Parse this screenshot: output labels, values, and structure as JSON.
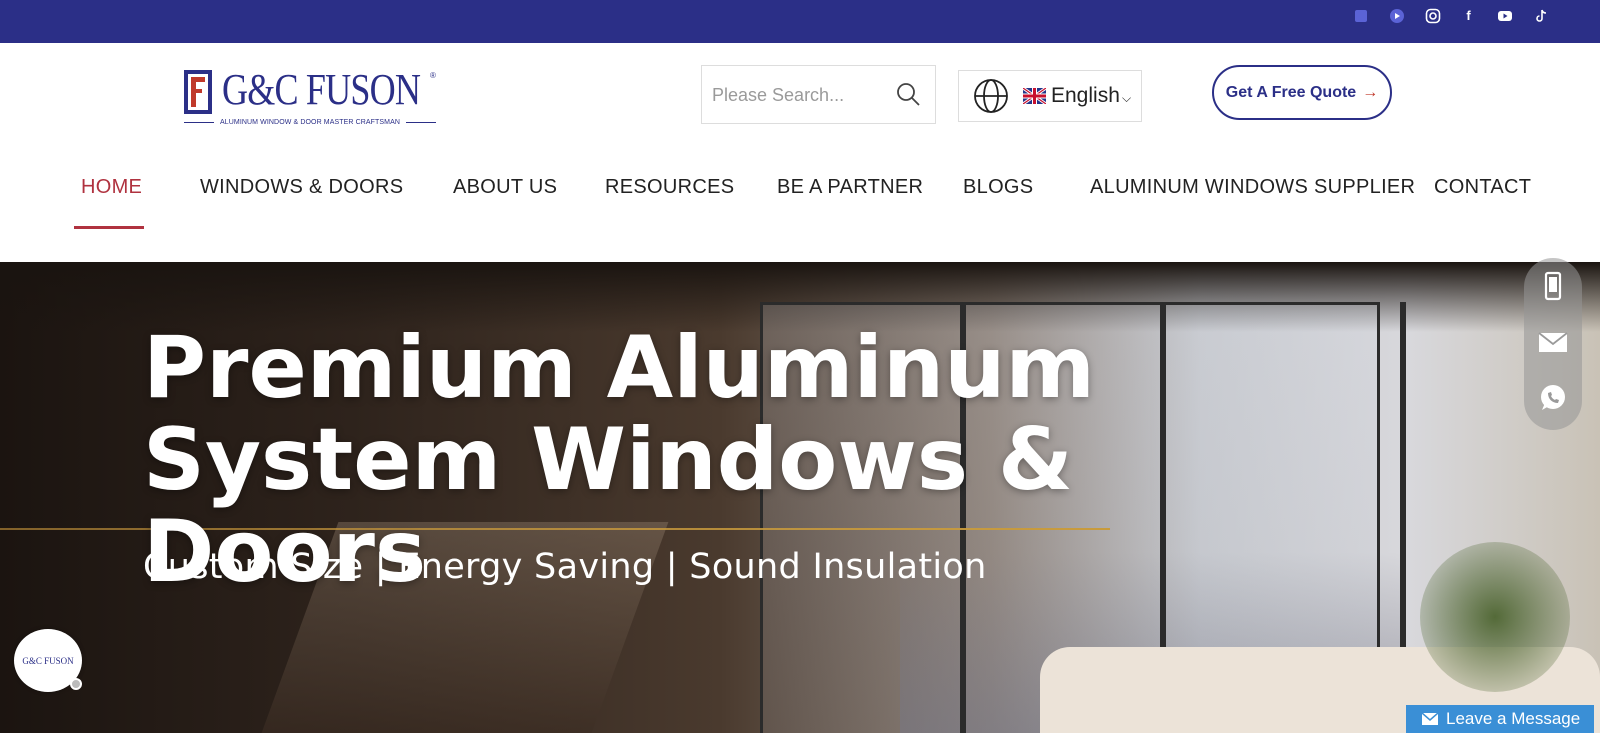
{
  "social": {
    "icons": [
      "square-icon",
      "circle-play-icon",
      "instagram-icon",
      "facebook-icon",
      "youtube-icon",
      "tiktok-icon"
    ],
    "facebook_glyph": "f"
  },
  "brand": {
    "name": "G&C FUSON",
    "tagline": "ALUMINUM WINDOW & DOOR MASTER CRAFTSMAN",
    "reg": "®",
    "color": "#2b2f87"
  },
  "search": {
    "placeholder": "Please Search..."
  },
  "language": {
    "selected": "English"
  },
  "cta": {
    "label": "Get A Free Quote",
    "arrow": "→"
  },
  "nav": {
    "items": [
      {
        "label": "HOME",
        "active": true
      },
      {
        "label": "WINDOWS & DOORS"
      },
      {
        "label": "ABOUT US"
      },
      {
        "label": "RESOURCES"
      },
      {
        "label": "BE A PARTNER"
      },
      {
        "label": "BLOGS"
      },
      {
        "label": "ALUMINUM WINDOWS SUPPLIER"
      },
      {
        "label": "CONTACT"
      }
    ],
    "active_color": "#b0323f"
  },
  "hero": {
    "title_line1": "Premium Aluminum",
    "title_line2": "System Windows & Doors",
    "subtitle": "Custom Size | Energy Saving | Sound Insulation"
  },
  "chat": {
    "avatar_text": "G&C FUSON",
    "leave_message": "Leave a Message"
  },
  "colors": {
    "topbar": "#2b2f87",
    "accent": "#b0323f",
    "leave_message_bg": "#3a8fd6"
  }
}
